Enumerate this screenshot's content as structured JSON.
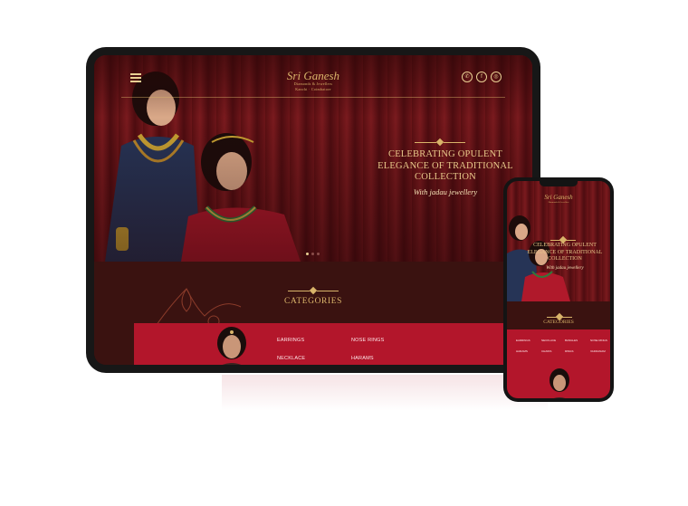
{
  "brand": {
    "name": "Sri Ganesh",
    "tagline": "Diamonds & Jewellers",
    "subtagline": "Kanchi · Coimbatore"
  },
  "header": {
    "socials": [
      "phone-icon",
      "facebook-icon",
      "instagram-icon"
    ]
  },
  "hero": {
    "headline": "CELEBRATING OPULENT ELEGANCE OF TRADITIONAL COLLECTION",
    "subline": "With jadau jewellery",
    "slides": 3,
    "active_slide": 1
  },
  "categories": {
    "title": "CATEGORIES",
    "items": [
      "EARRINGS",
      "NOSE RINGS",
      "NECKLACE",
      "HARAMS"
    ]
  },
  "phone": {
    "categories": [
      "EARRINGS",
      "NECKLACE",
      "BANGLES",
      "NOSE RINGS",
      "HARAMS",
      "CHAINS",
      "RINGS",
      "VADDANAM"
    ]
  },
  "colors": {
    "maroon": "#3a1210",
    "curtain": "#6d1519",
    "gold": "#d9b46a",
    "crimson_panel": "#b3162b"
  }
}
